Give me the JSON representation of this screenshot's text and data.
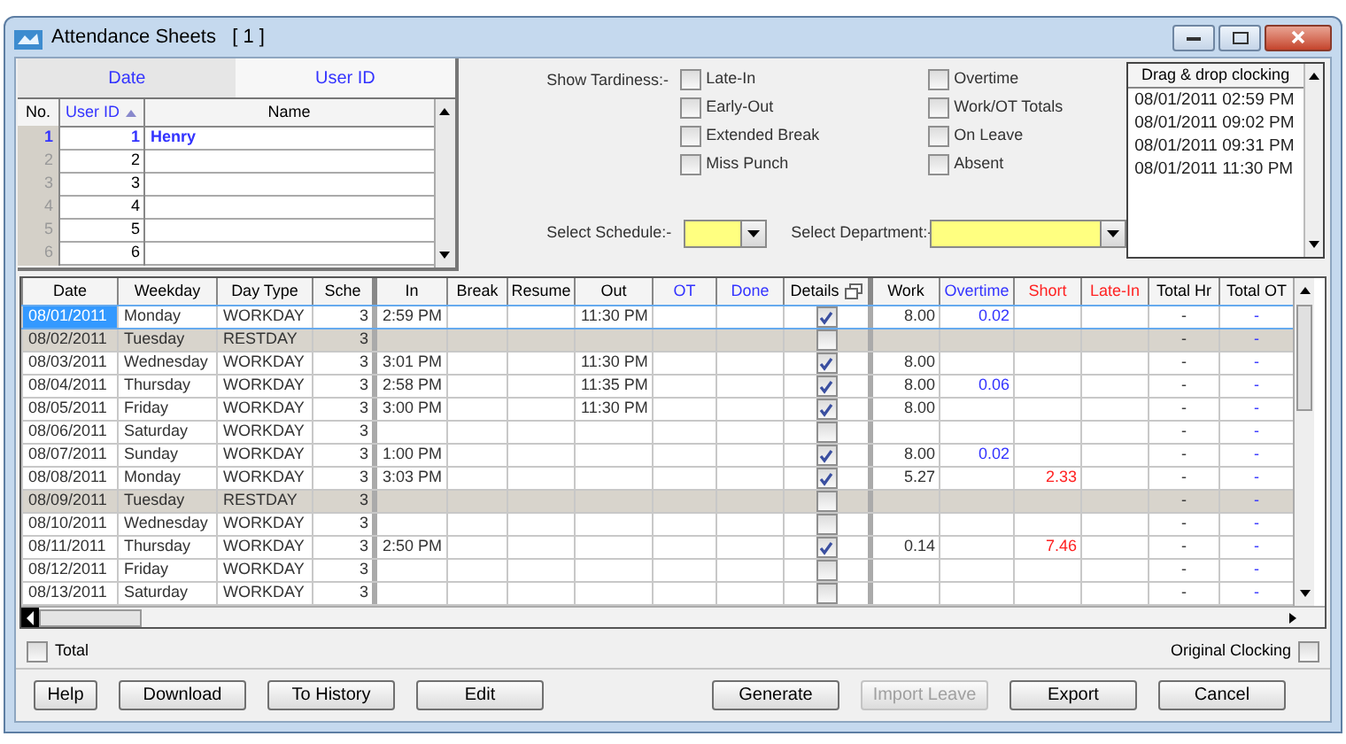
{
  "window": {
    "title": "Attendance Sheets   [ 1 ]"
  },
  "user_panel": {
    "tabs": [
      {
        "label": "Date",
        "selected": false
      },
      {
        "label": "User ID",
        "selected": true
      }
    ],
    "columns": [
      "No.",
      "User ID",
      "Name"
    ],
    "rows": [
      {
        "no": "1",
        "user_id": "1",
        "name": "Henry",
        "selected": true
      },
      {
        "no": "2",
        "user_id": "2",
        "selected": false
      },
      {
        "no": "3",
        "user_id": "3",
        "selected": false
      },
      {
        "no": "4",
        "user_id": "4",
        "selected": false
      },
      {
        "no": "5",
        "user_id": "5",
        "selected": false
      },
      {
        "no": "6",
        "user_id": "6",
        "selected": false
      }
    ]
  },
  "tardiness": {
    "label": "Show Tardiness:-",
    "options": [
      {
        "label": "Late-In",
        "checked": false
      },
      {
        "label": "Early-Out",
        "checked": false
      },
      {
        "label": "Extended Break",
        "checked": false
      },
      {
        "label": "Miss Punch",
        "checked": false
      },
      {
        "label": "Overtime",
        "checked": false
      },
      {
        "label": "Work/OT Totals",
        "checked": false
      },
      {
        "label": "On Leave",
        "checked": false
      },
      {
        "label": "Absent",
        "checked": false
      }
    ]
  },
  "schedule": {
    "label": "Select Schedule:-"
  },
  "department": {
    "label": "Select Department:-"
  },
  "clocking": {
    "title": "Drag & drop clocking",
    "items": [
      "08/01/2011 02:59 PM",
      "08/01/2011 09:02 PM",
      "08/01/2011 09:31 PM",
      "08/01/2011 11:30 PM"
    ]
  },
  "table": {
    "columns": [
      {
        "label": "Date",
        "color": "#000000"
      },
      {
        "label": "Weekday",
        "color": "#000000"
      },
      {
        "label": "Day Type",
        "color": "#000000"
      },
      {
        "label": "Sche",
        "color": "#000000"
      },
      {
        "label": "In",
        "color": "#000000"
      },
      {
        "label": "Break",
        "color": "#000000"
      },
      {
        "label": "Resume",
        "color": "#000000"
      },
      {
        "label": "Out",
        "color": "#000000"
      },
      {
        "label": "OT",
        "color": "#3333ff"
      },
      {
        "label": "Done",
        "color": "#3333ff"
      },
      {
        "label": "Details",
        "color": "#000000"
      },
      {
        "label": "Work",
        "color": "#000000"
      },
      {
        "label": "Overtime",
        "color": "#3333ff"
      },
      {
        "label": "Short",
        "color": "#ff2222"
      },
      {
        "label": "Late-In",
        "color": "#ff2222"
      },
      {
        "label": "Total Hr",
        "color": "#000000"
      },
      {
        "label": "Total OT",
        "color": "#000000"
      }
    ],
    "rows": [
      {
        "date": "08/01/2011",
        "weekday": "Monday",
        "day_type": "WORKDAY",
        "sche": "3",
        "in": "2:59 PM",
        "out": "11:30 PM",
        "details": true,
        "work": "8.00",
        "overtime": "0.02",
        "total_hr": "-",
        "total_ot": "-",
        "shaded": false,
        "selected": true
      },
      {
        "date": "08/02/2011",
        "weekday": "Tuesday",
        "day_type": "RESTDAY",
        "sche": "3",
        "details": false,
        "total_hr": "-",
        "total_ot": "-",
        "shaded": true,
        "selected": false
      },
      {
        "date": "08/03/2011",
        "weekday": "Wednesday",
        "day_type": "WORKDAY",
        "sche": "3",
        "in": "3:01 PM",
        "out": "11:30 PM",
        "details": true,
        "work": "8.00",
        "total_hr": "-",
        "total_ot": "-",
        "shaded": false,
        "selected": false
      },
      {
        "date": "08/04/2011",
        "weekday": "Thursday",
        "day_type": "WORKDAY",
        "sche": "3",
        "in": "2:58 PM",
        "out": "11:35 PM",
        "details": true,
        "work": "8.00",
        "overtime": "0.06",
        "total_hr": "-",
        "total_ot": "-",
        "shaded": false,
        "selected": false
      },
      {
        "date": "08/05/2011",
        "weekday": "Friday",
        "day_type": "WORKDAY",
        "sche": "3",
        "in": "3:00 PM",
        "out": "11:30 PM",
        "details": true,
        "work": "8.00",
        "total_hr": "-",
        "total_ot": "-",
        "shaded": false,
        "selected": false
      },
      {
        "date": "08/06/2011",
        "weekday": "Saturday",
        "day_type": "WORKDAY",
        "sche": "3",
        "details": false,
        "total_hr": "-",
        "total_ot": "-",
        "shaded": false,
        "selected": false
      },
      {
        "date": "08/07/2011",
        "weekday": "Sunday",
        "day_type": "WORKDAY",
        "sche": "3",
        "in": "1:00 PM",
        "details": true,
        "work": "8.00",
        "overtime": "0.02",
        "total_hr": "-",
        "total_ot": "-",
        "shaded": false,
        "selected": false
      },
      {
        "date": "08/08/2011",
        "weekday": "Monday",
        "day_type": "WORKDAY",
        "sche": "3",
        "in": "3:03 PM",
        "details": true,
        "work": "5.27",
        "short": "2.33",
        "total_hr": "-",
        "total_ot": "-",
        "shaded": false,
        "selected": false
      },
      {
        "date": "08/09/2011",
        "weekday": "Tuesday",
        "day_type": "RESTDAY",
        "sche": "3",
        "details": false,
        "total_hr": "-",
        "total_ot": "-",
        "shaded": true,
        "selected": false
      },
      {
        "date": "08/10/2011",
        "weekday": "Wednesday",
        "day_type": "WORKDAY",
        "sche": "3",
        "details": false,
        "total_hr": "-",
        "total_ot": "-",
        "shaded": false,
        "selected": false
      },
      {
        "date": "08/11/2011",
        "weekday": "Thursday",
        "day_type": "WORKDAY",
        "sche": "3",
        "in": "2:50 PM",
        "details": true,
        "work": "0.14",
        "short": "7.46",
        "total_hr": "-",
        "total_ot": "-",
        "shaded": false,
        "selected": false
      },
      {
        "date": "08/12/2011",
        "weekday": "Friday",
        "day_type": "WORKDAY",
        "sche": "3",
        "details": false,
        "total_hr": "-",
        "total_ot": "-",
        "shaded": false,
        "selected": false
      },
      {
        "date": "08/13/2011",
        "weekday": "Saturday",
        "day_type": "WORKDAY",
        "sche": "3",
        "details": false,
        "total_hr": "-",
        "total_ot": "-",
        "shaded": false,
        "selected": false
      }
    ]
  },
  "total": {
    "label": "Total",
    "checked": false
  },
  "original_clocking": {
    "label": "Original Clocking",
    "checked": false
  },
  "buttons": [
    {
      "label": "Help",
      "disabled": false
    },
    {
      "label": "Download",
      "disabled": false
    },
    {
      "label": "To History",
      "disabled": false
    },
    {
      "label": "Edit",
      "disabled": false
    },
    {
      "label": "Generate",
      "disabled": false
    },
    {
      "label": "Import Leave",
      "disabled": true
    },
    {
      "label": "Export",
      "disabled": false
    },
    {
      "label": "Cancel",
      "disabled": false
    }
  ]
}
